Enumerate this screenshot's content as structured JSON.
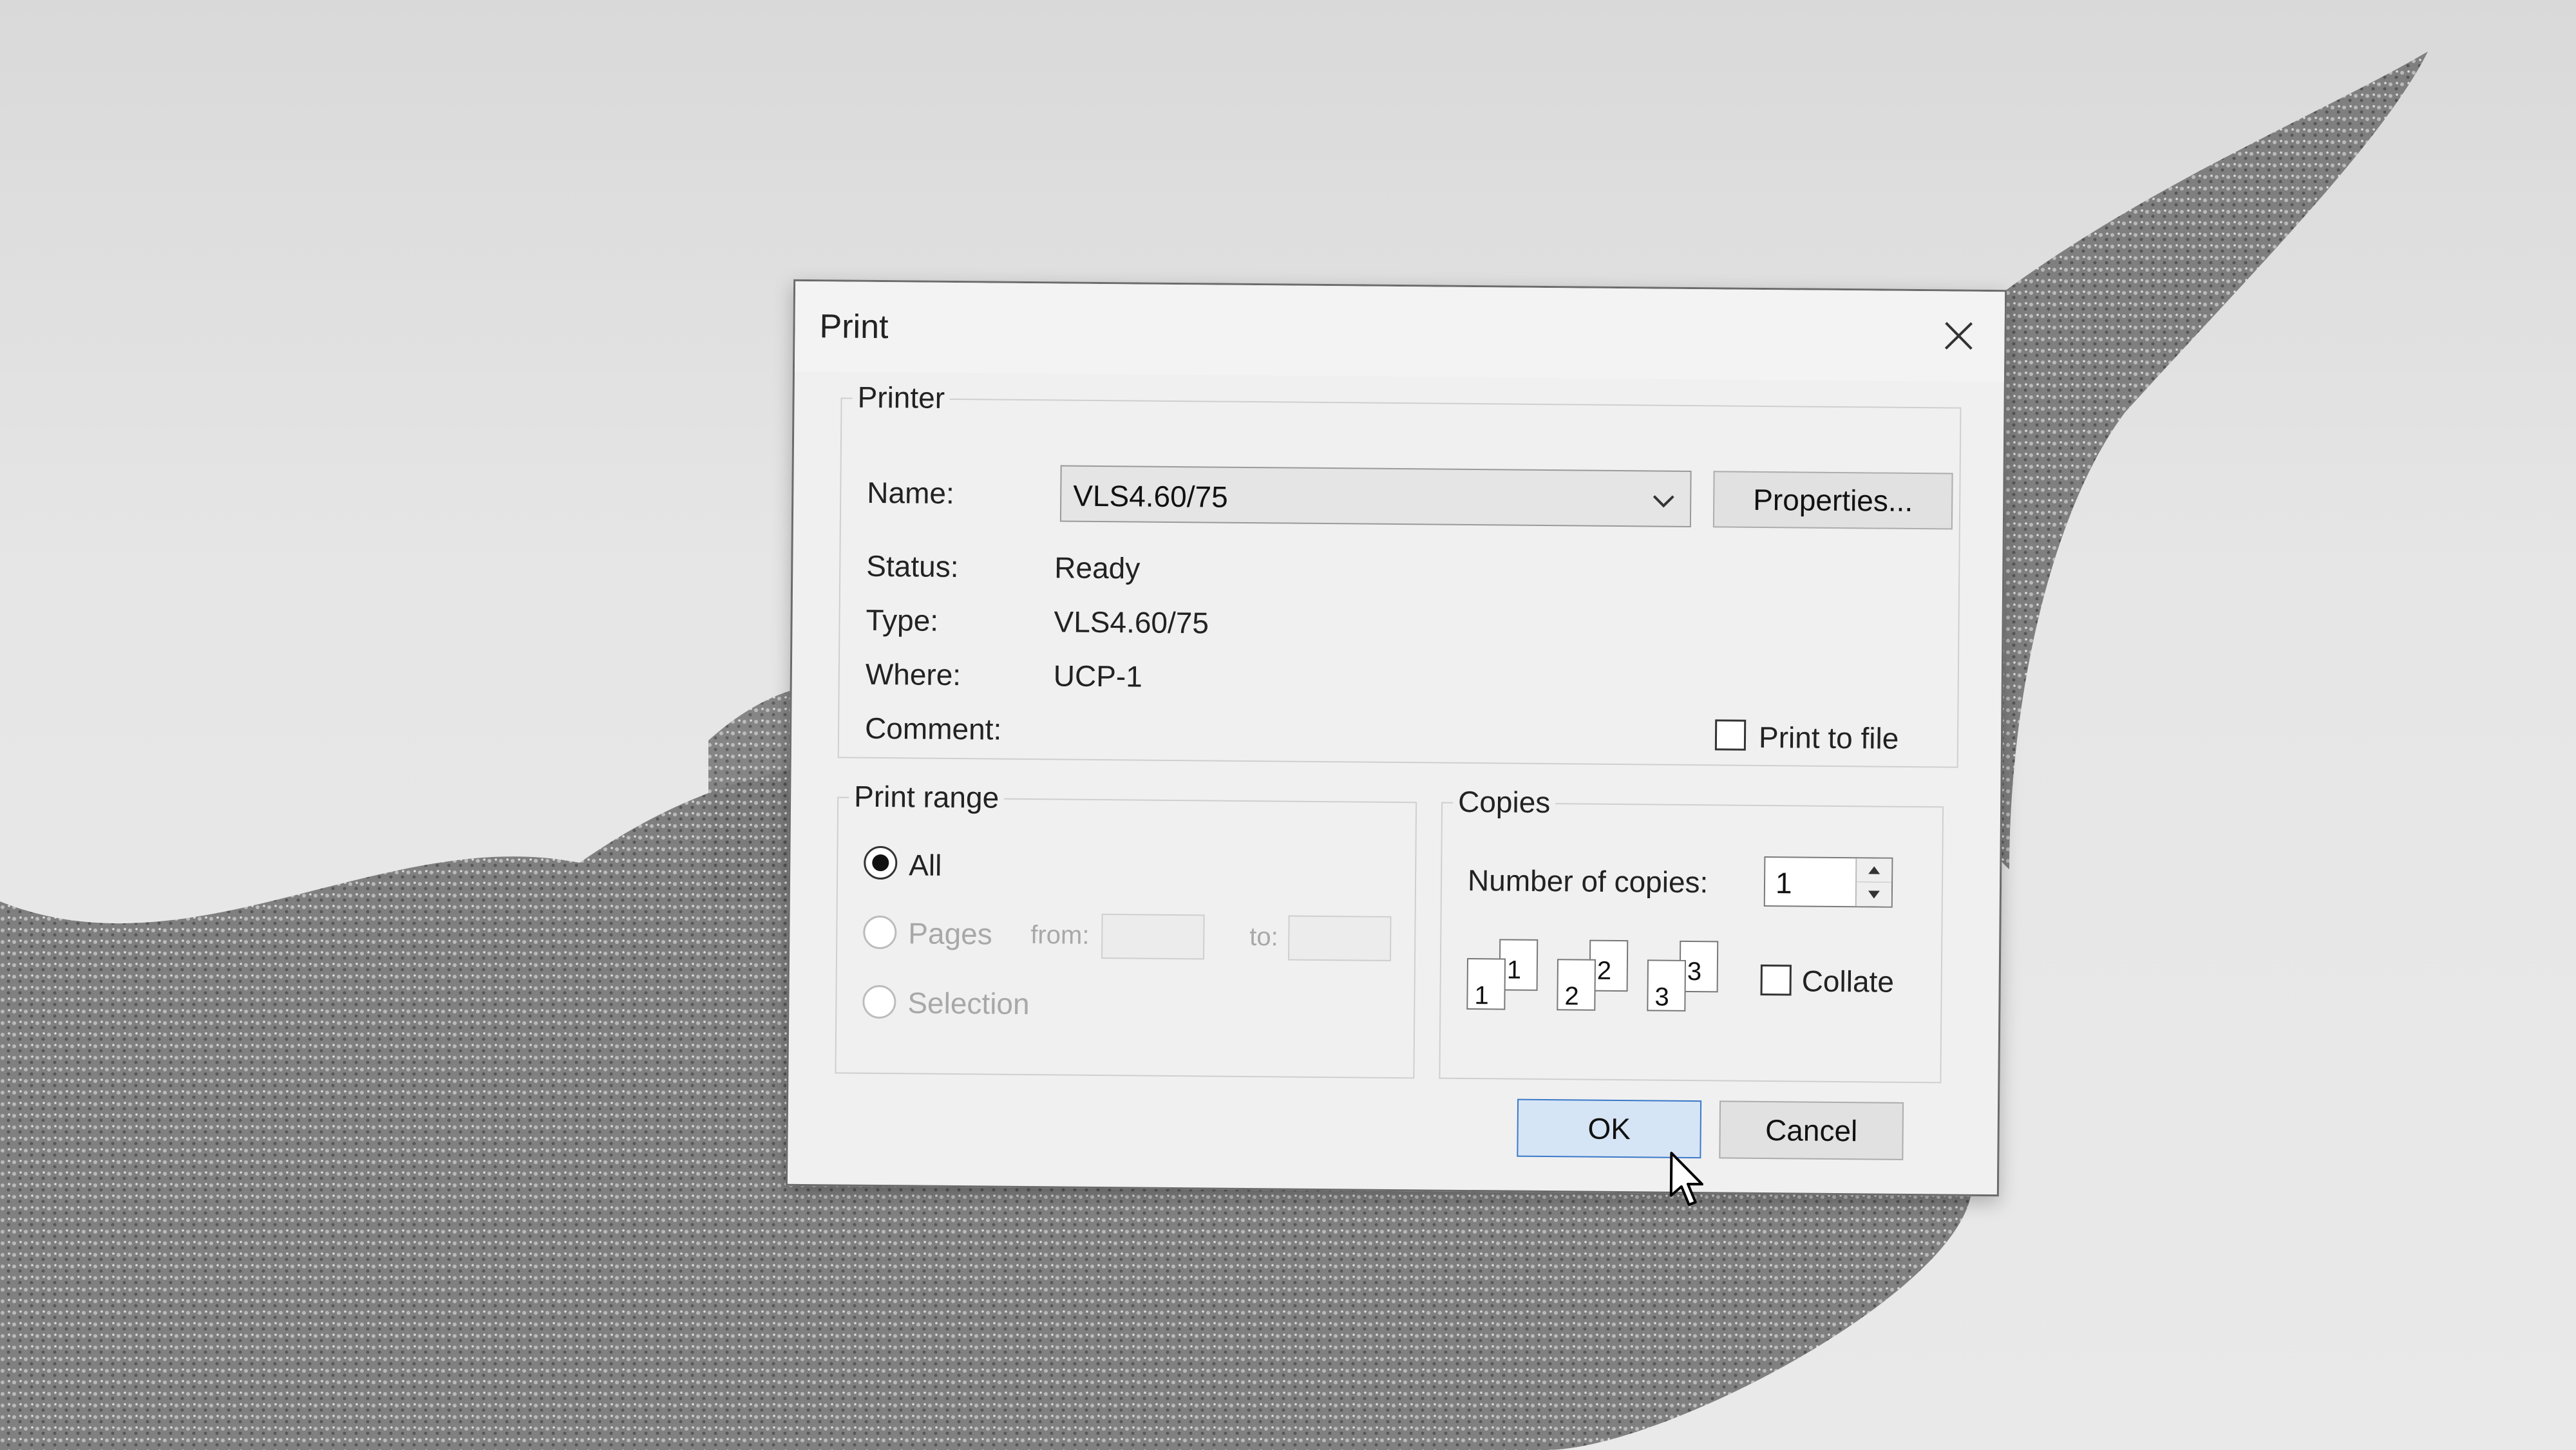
{
  "dialog": {
    "title": "Print",
    "printer_group": {
      "title": "Printer",
      "name_label": "Name:",
      "name_value": "VLS4.60/75",
      "properties_label": "Properties...",
      "status_label": "Status:",
      "status_value": "Ready",
      "type_label": "Type:",
      "type_value": "VLS4.60/75",
      "where_label": "Where:",
      "where_value": "UCP-1",
      "comment_label": "Comment:",
      "print_to_file_label": "Print to file"
    },
    "print_range": {
      "title": "Print range",
      "all_label": "All",
      "pages_label": "Pages",
      "from_label": "from:",
      "to_label": "to:",
      "selection_label": "Selection"
    },
    "copies": {
      "title": "Copies",
      "number_label": "Number of copies:",
      "number_value": "1",
      "collate_label": "Collate",
      "collate_icons": [
        "1",
        "1",
        "2",
        "2",
        "3",
        "3"
      ]
    },
    "buttons": {
      "ok": "OK",
      "cancel": "Cancel"
    }
  },
  "colors": {
    "ok_border": "#3b79c9",
    "ok_fill": "#d6e5f5",
    "dialog_bg": "#f0f0f0"
  },
  "icons": [
    "close-icon",
    "chevron-down-icon",
    "spinner-up-icon",
    "spinner-down-icon",
    "mouse-cursor-icon"
  ]
}
